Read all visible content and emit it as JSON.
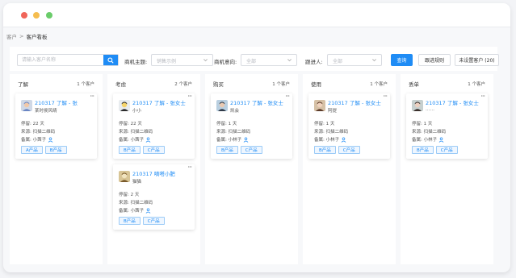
{
  "window": {
    "title": ""
  },
  "breadcrumb": {
    "parent": "客户",
    "separator": ">",
    "current": "客户看板"
  },
  "filters": {
    "search_placeholder": "请输入客户名称",
    "opportunity_topic_label": "商机主题:",
    "opportunity_topic_value": "销售示例",
    "opportunity_intent_label": "商机意向:",
    "opportunity_intent_value": "全部",
    "follower_label": "跟进人:",
    "follower_value": "全部",
    "query_button": "查询",
    "follow_rules_button": "跟进规则",
    "unset_customers_button": "未设置客户 (20)"
  },
  "columns": [
    {
      "title": "了解",
      "count": "1 个客户",
      "cards": [
        {
          "name": "210317 了解 - 张",
          "sub": "某时侯风晴",
          "avatar": "avatar-cartoon",
          "stay": "停留: 22 天",
          "source": "来源: 扫描二维码",
          "owner": "备属: 小茜子",
          "tags": [
            "A产品",
            "B产品"
          ]
        }
      ]
    },
    {
      "title": "考虑",
      "count": "2 个客户",
      "cards": [
        {
          "name": "210317 了解 - 张女士",
          "sub": "小小",
          "avatar": "avatar-bird",
          "stay": "停留: 22 天",
          "source": "来源: 扫描二维码",
          "owner": "备属: 小茜子",
          "tags": [
            "B产品",
            "C产品"
          ]
        },
        {
          "name": "210317 嘀嗒小肥",
          "sub": "猫猫",
          "avatar": "avatar-pet",
          "stay": "停留: 2 天",
          "source": "来源: 扫描二维码",
          "owner": "备属: 小茜子",
          "tags": [
            "B产品",
            "C产品"
          ]
        }
      ]
    },
    {
      "title": "购买",
      "count": "1 个客户",
      "cards": [
        {
          "name": "210317 了解 - 张女士",
          "sub": "凯会",
          "avatar": "avatar-boy",
          "stay": "停留: 1 天",
          "source": "来源: 扫描二维码",
          "owner": "备属: 小林子",
          "tags": [
            "B产品",
            "C产品"
          ]
        }
      ]
    },
    {
      "title": "使用",
      "count": "1 个客户",
      "cards": [
        {
          "name": "210317 了解 - 张女士",
          "sub": "阿提",
          "avatar": "avatar-girl",
          "stay": "停留: 1 天",
          "source": "来源: 扫描二维码",
          "owner": "备属: 小林子",
          "tags": [
            "B产品",
            "C产品"
          ]
        }
      ]
    },
    {
      "title": "丢单",
      "count": "1 个客户",
      "cards": [
        {
          "name": "210317 了解 - 张女士",
          "sub": "……",
          "avatar": "avatar-woman",
          "stay": "停留: 1 天",
          "source": "来源: 扫描二维码",
          "owner": "备属: 小林子",
          "tags": [
            "B产品",
            "C产品"
          ]
        }
      ]
    }
  ],
  "colors": {
    "accent": "#1f8cf5",
    "tag_bg": "#eef6ff",
    "tag_border": "#9ccbf7"
  }
}
